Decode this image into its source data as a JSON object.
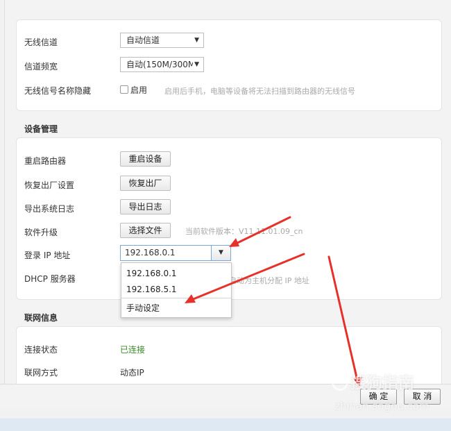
{
  "wireless": {
    "channel_label": "无线信道",
    "channel_value": "自动信道",
    "bandwidth_label": "信道频宽",
    "bandwidth_value": "自动(150M/300M",
    "ssid_hide_label": "无线信号名称隐藏",
    "ssid_hide_checkbox_label": "启用",
    "ssid_hide_hint": "启用后手机，电脑等设备将无法扫描到路由器的无线信号"
  },
  "device_mgmt": {
    "title": "设备管理",
    "reboot_label": "重启路由器",
    "reboot_button": "重启设备",
    "reset_label": "恢复出厂设置",
    "reset_button": "恢复出厂",
    "export_log_label": "导出系统日志",
    "export_log_button": "导出日志",
    "upgrade_label": "软件升级",
    "upgrade_button": "选择文件",
    "version_hint": "当前软件版本：V11.11.01.09_cn",
    "login_ip_label": "登录 IP 地址",
    "login_ip_value": "192.168.0.1",
    "login_ip_options": [
      "192.168.0.1",
      "192.168.5.1",
      "手动设定"
    ],
    "dhcp_label": "DHCP 服务器",
    "dhcp_hint": "路由器自动为主机分配 IP 地址"
  },
  "network_info": {
    "title": "联网信息",
    "status_label": "连接状态",
    "status_value": "已连接",
    "mode_label": "联网方式",
    "mode_value": "动态IP"
  },
  "footer": {
    "ok_button": "确 定",
    "cancel_button": "取 消"
  },
  "watermark": {
    "brand": "搜狗指南",
    "url": "zhinan.sogou.com"
  },
  "colors": {
    "arrow": "#e8302a",
    "status_ok": "#3a8a2a",
    "select_focus_border": "#7aa7d6"
  },
  "icons": {
    "dropdown_caret": "triangle-down",
    "checkbox": "square"
  }
}
